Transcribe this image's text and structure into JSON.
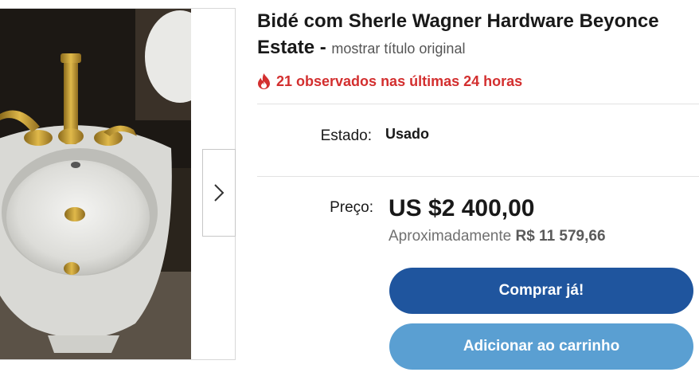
{
  "product": {
    "title_line1": "Bidé com Sherle Wagner Hardware Beyonce",
    "title_line2": "Estate",
    "title_separator": "-",
    "show_original_label": "mostrar título original"
  },
  "watchers": {
    "text": "21 observados nas últimas 24 horas",
    "icon": "fire-icon",
    "color": "#d32f2f"
  },
  "condition": {
    "label": "Estado:",
    "value": "Usado"
  },
  "pricing": {
    "label": "Preço:",
    "price": "US $2 400,00",
    "approx_prefix": "Aproximadamente",
    "approx_value": "R$ 11 579,66"
  },
  "actions": {
    "buy_now": "Comprar já!",
    "add_to_cart": "Adicionar ao carrinho",
    "buy_color": "#1f559e",
    "cart_color": "#5a9fd2"
  },
  "gallery": {
    "next_icon": "chevron-right-icon"
  }
}
